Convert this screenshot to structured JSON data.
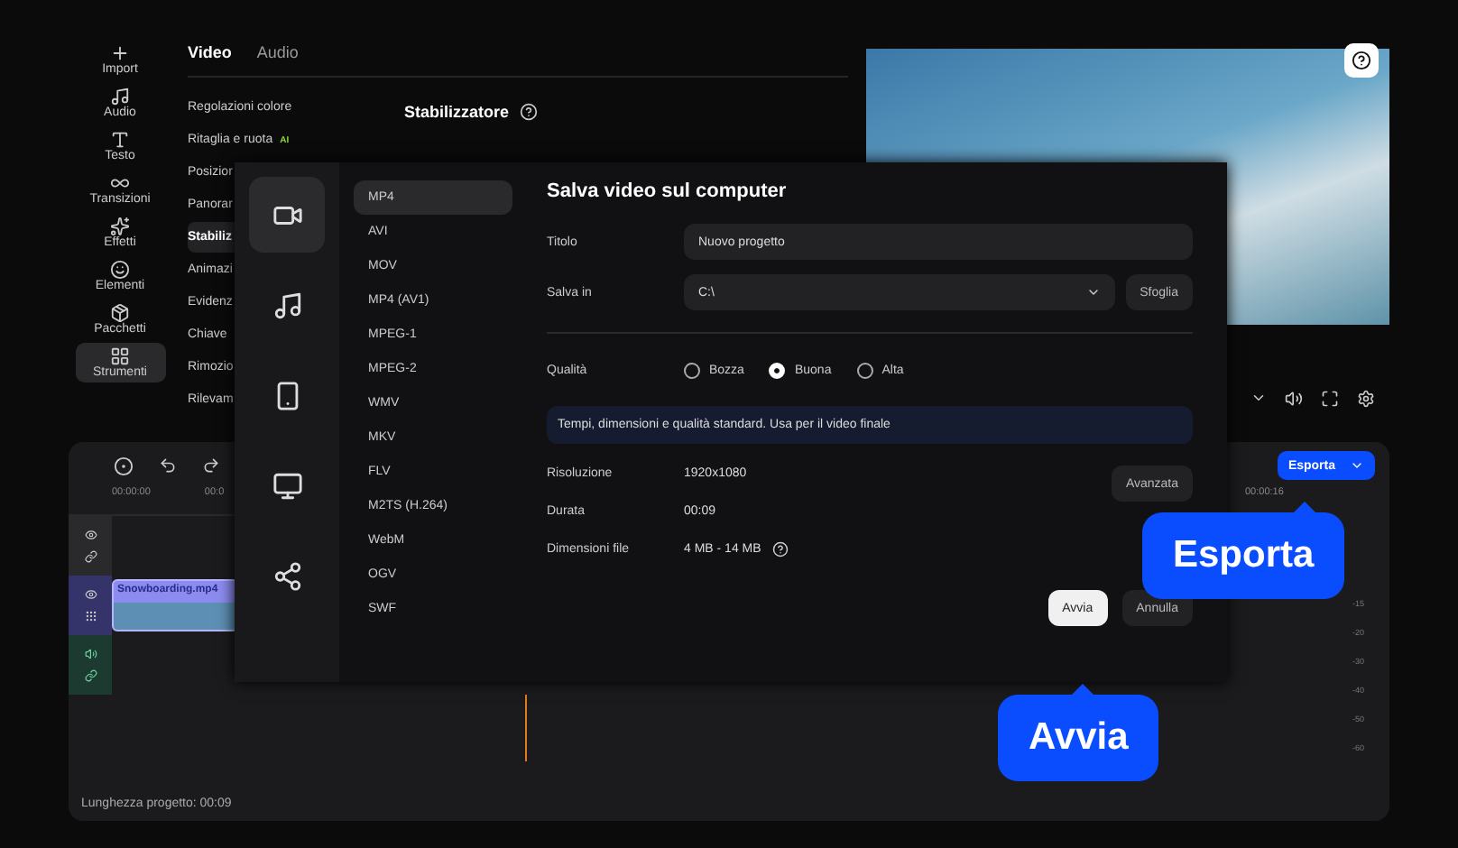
{
  "sidebar": {
    "items": [
      {
        "label": "Import",
        "selected": false
      },
      {
        "label": "Audio",
        "selected": false
      },
      {
        "label": "Testo",
        "selected": false
      },
      {
        "label": "Transizioni",
        "selected": false
      },
      {
        "label": "Effetti",
        "selected": false
      },
      {
        "label": "Elementi",
        "selected": false
      },
      {
        "label": "Pacchetti",
        "selected": false
      },
      {
        "label": "Strumenti",
        "selected": true
      }
    ]
  },
  "properties": {
    "tabs": [
      {
        "label": "Video",
        "selected": true
      },
      {
        "label": "Audio",
        "selected": false
      }
    ],
    "items": [
      {
        "label": "Regolazioni colore",
        "selected": false
      },
      {
        "label": "Ritaglia e ruota",
        "badge": "AI",
        "selected": false
      },
      {
        "label": "Posizior",
        "selected": false
      },
      {
        "label": "Panorar",
        "selected": false
      },
      {
        "label": "Stabiliz",
        "selected": true
      },
      {
        "label": "Animazi",
        "selected": false
      },
      {
        "label": "Evidenz",
        "selected": false
      },
      {
        "label": "Chiave",
        "selected": false
      },
      {
        "label": "Rimozio",
        "selected": false
      },
      {
        "label": "Rilevam",
        "selected": false
      }
    ],
    "heading": "Stabilizzatore"
  },
  "timeline": {
    "timecodes": [
      "00:00:00",
      "00:0"
    ],
    "clip": "Snowboarding.mp4",
    "end_timecode": "00:00:16",
    "meter_labels": [
      "-15",
      "-20",
      "-30",
      "-40",
      "-50",
      "-60"
    ],
    "project_length": "Lunghezza progetto: 00:09"
  },
  "export_button": {
    "label": "Esporta"
  },
  "dialog": {
    "categories": [
      {
        "kind": "video",
        "selected": true
      },
      {
        "kind": "audio",
        "selected": false
      },
      {
        "kind": "device",
        "selected": false
      },
      {
        "kind": "tv",
        "selected": false
      },
      {
        "kind": "share",
        "selected": false
      }
    ],
    "formats": [
      {
        "label": "MP4",
        "selected": true
      },
      {
        "label": "AVI",
        "selected": false
      },
      {
        "label": "MOV",
        "selected": false
      },
      {
        "label": "MP4 (AV1)",
        "selected": false
      },
      {
        "label": "MPEG-1",
        "selected": false
      },
      {
        "label": "MPEG-2",
        "selected": false
      },
      {
        "label": "WMV",
        "selected": false
      },
      {
        "label": "MKV",
        "selected": false
      },
      {
        "label": "FLV",
        "selected": false
      },
      {
        "label": "M2TS (H.264)",
        "selected": false
      },
      {
        "label": "WebM",
        "selected": false
      },
      {
        "label": "OGV",
        "selected": false
      },
      {
        "label": "SWF",
        "selected": false
      }
    ],
    "title": "Salva video sul computer",
    "fields": [
      {
        "label": "Titolo",
        "value": "Nuovo progetto"
      },
      {
        "label": "Salva in",
        "value": "C:\\",
        "button": "Sfoglia"
      }
    ],
    "quality": {
      "label": "Qualità",
      "options": [
        {
          "label": "Bozza",
          "selected": false
        },
        {
          "label": "Buona",
          "selected": true
        },
        {
          "label": "Alta",
          "selected": false
        }
      ]
    },
    "note": "Tempi, dimensioni e qualità standard. Usa per il video finale",
    "info": [
      {
        "label": "Risoluzione",
        "value": "1920x1080"
      },
      {
        "label": "Durata",
        "value": "00:09"
      },
      {
        "label": "Dimensioni file",
        "value": "4 MB - 14 MB",
        "help": true
      }
    ],
    "advanced": "Avanzata",
    "buttons": [
      {
        "label": "Avvia",
        "kind": "primary"
      },
      {
        "label": "Annulla",
        "kind": "secondary"
      }
    ]
  },
  "callouts": [
    {
      "label": "Esporta"
    },
    {
      "label": "Avvia"
    }
  ]
}
